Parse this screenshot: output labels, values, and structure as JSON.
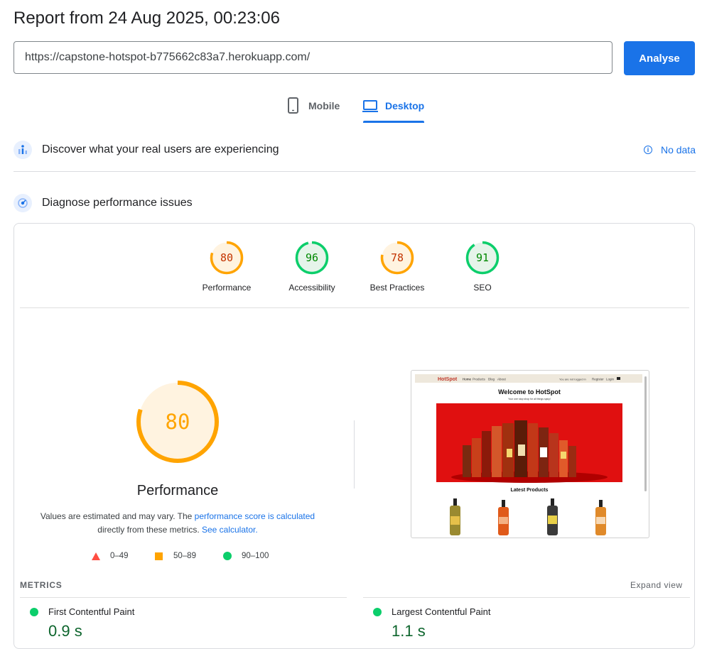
{
  "header": {
    "title": "Report from 24 Aug 2025, 00:23:06"
  },
  "url_bar": {
    "value": "https://capstone-hotspot-b775662c83a7.herokuapp.com/",
    "button_label": "Analyse"
  },
  "tabs": [
    {
      "label": "Mobile",
      "icon": "phone-icon",
      "active": false
    },
    {
      "label": "Desktop",
      "icon": "laptop-icon",
      "active": true
    }
  ],
  "field_data": {
    "title": "Discover what your real users are experiencing",
    "status": "No data"
  },
  "lab_data": {
    "title": "Diagnose performance issues"
  },
  "scores": [
    {
      "label": "Performance",
      "value": "80",
      "color": "#ffa400",
      "fill": "#fff3e0",
      "text_color": "#c33300"
    },
    {
      "label": "Accessibility",
      "value": "96",
      "color": "#0cce6b",
      "fill": "#e6f4ea",
      "text_color": "#008800"
    },
    {
      "label": "Best Practices",
      "value": "78",
      "color": "#ffa400",
      "fill": "#fff3e0",
      "text_color": "#c33300"
    },
    {
      "label": "SEO",
      "value": "91",
      "color": "#0cce6b",
      "fill": "#e6f4ea",
      "text_color": "#008800"
    }
  ],
  "performance": {
    "score": "80",
    "title": "Performance",
    "desc_1": "Values are estimated and may vary. The ",
    "desc_link_1": "performance score is calculated",
    "desc_2": "directly from these metrics. ",
    "desc_link_2": "See calculator."
  },
  "legend": [
    {
      "range": "0–49",
      "color": "#ff4e42"
    },
    {
      "range": "50–89",
      "color": "#ffa400"
    },
    {
      "range": "90–100",
      "color": "#0cce6b"
    }
  ],
  "screenshot": {
    "brand": "HotSpot",
    "nav": [
      "Home",
      "Products",
      "Blog",
      "About"
    ],
    "right_nav": [
      "You are not logged in",
      "Register",
      "Login"
    ],
    "heading": "Welcome to HotSpot",
    "subheading": "Your one stop shop for all things spicy!",
    "section": "Latest Products"
  },
  "metrics": {
    "label": "METRICS",
    "expand": "Expand view",
    "items": [
      {
        "name": "First Contentful Paint",
        "value": "0.9 s"
      },
      {
        "name": "Largest Contentful Paint",
        "value": "1.1 s"
      }
    ]
  }
}
